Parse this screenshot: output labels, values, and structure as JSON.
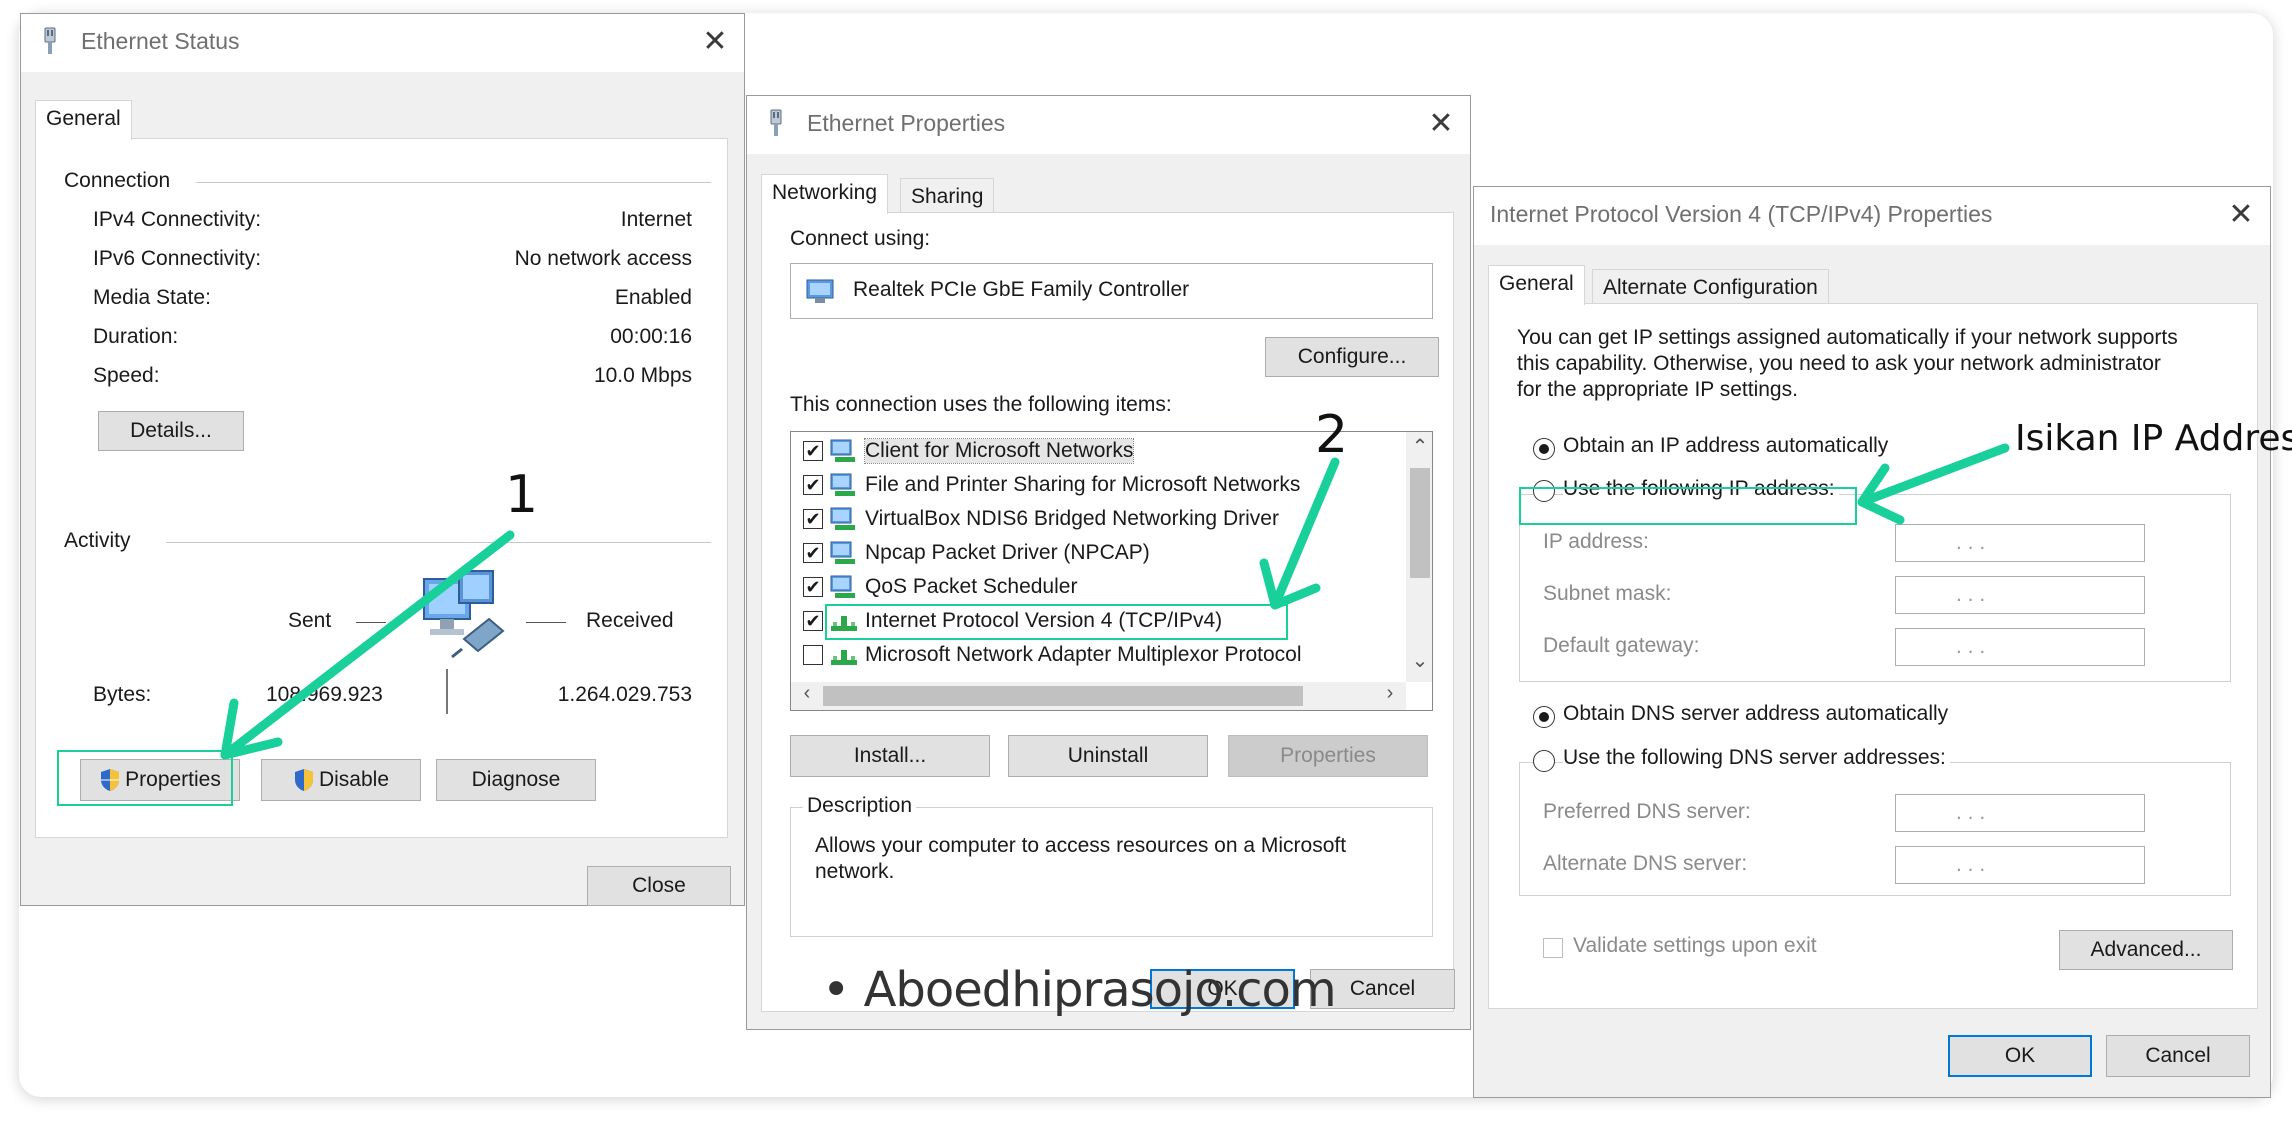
{
  "status_dialog": {
    "title": "Ethernet Status",
    "tab": "General",
    "connection_label": "Connection",
    "rows": [
      {
        "label": "IPv4 Connectivity:",
        "value": "Internet"
      },
      {
        "label": "IPv6 Connectivity:",
        "value": "No network access"
      },
      {
        "label": "Media State:",
        "value": "Enabled"
      },
      {
        "label": "Duration:",
        "value": "00:00:16"
      },
      {
        "label": "Speed:",
        "value": "10.0 Mbps"
      }
    ],
    "details_button": "Details...",
    "activity_label": "Activity",
    "sent_label": "Sent",
    "received_label": "Received",
    "bytes_label": "Bytes:",
    "bytes_sent": "108.969.923",
    "bytes_received": "1.264.029.753",
    "properties_button": "Properties",
    "disable_button": "Disable",
    "diagnose_button": "Diagnose",
    "close_button": "Close"
  },
  "props_dialog": {
    "title": "Ethernet Properties",
    "tabs": [
      "Networking",
      "Sharing"
    ],
    "connect_using_label": "Connect using:",
    "adapter": "Realtek PCIe GbE Family Controller",
    "configure_button": "Configure...",
    "items_label": "This connection uses the following items:",
    "items": [
      {
        "label": "Client for Microsoft Networks",
        "checked": true,
        "icon": "network-client-icon"
      },
      {
        "label": "File and Printer Sharing for Microsoft Networks",
        "checked": true,
        "icon": "network-service-icon"
      },
      {
        "label": "VirtualBox NDIS6 Bridged Networking Driver",
        "checked": true,
        "icon": "network-service-icon"
      },
      {
        "label": "Npcap Packet Driver (NPCAP)",
        "checked": true,
        "icon": "network-service-icon"
      },
      {
        "label": "QoS Packet Scheduler",
        "checked": true,
        "icon": "network-service-icon"
      },
      {
        "label": "Internet Protocol Version 4 (TCP/IPv4)",
        "checked": true,
        "icon": "protocol-icon"
      },
      {
        "label": "Microsoft Network Adapter Multiplexor Protocol",
        "checked": false,
        "icon": "protocol-icon"
      }
    ],
    "install_button": "Install...",
    "uninstall_button": "Uninstall",
    "properties_button": "Properties",
    "description_label": "Description",
    "description_text_1": "Allows your computer to access resources on a Microsoft",
    "description_text_2": "network.",
    "ok_button": "OK",
    "cancel_button": "Cancel"
  },
  "ipv4_dialog": {
    "title": "Internet Protocol Version 4 (TCP/IPv4) Properties",
    "tabs": [
      "General",
      "Alternate Configuration"
    ],
    "intro_1": "You can get IP settings assigned automatically if your network supports",
    "intro_2": "this capability. Otherwise, you need to ask your network administrator",
    "intro_3": "for the appropriate IP settings.",
    "obtain_ip_auto": "Obtain an IP address automatically",
    "use_following_ip": "Use the following IP address:",
    "ip_fields": [
      "IP address:",
      "Subnet mask:",
      "Default gateway:"
    ],
    "obtain_dns_auto": "Obtain DNS server address automatically",
    "use_following_dns": "Use the following DNS server addresses:",
    "dns_fields": [
      "Preferred DNS server:",
      "Alternate DNS server:"
    ],
    "ip_placeholder": ".       .       .",
    "validate_label": "Validate settings upon exit",
    "advanced_button": "Advanced...",
    "ok_button": "OK",
    "cancel_button": "Cancel"
  },
  "annotations": {
    "step1": "1",
    "step2": "2",
    "isikan": "Isikan IP Address",
    "watermark": "• Aboedhiprasojo.com",
    "arrow_color": "#1ad09a"
  }
}
